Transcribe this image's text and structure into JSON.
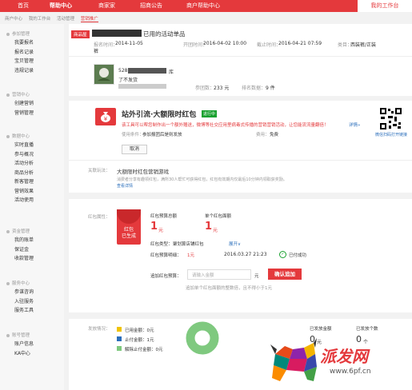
{
  "topnav": {
    "home": "首页",
    "help": "帮助中心",
    "rules": "规则",
    "seller": "商家家",
    "announce": "招商公告",
    "merchant_help": "商户帮助中心",
    "my_workbench": "我的工作台"
  },
  "breadcrumb": [
    "商户中心",
    "我的工作台",
    "活动管理",
    "营销推广"
  ],
  "sidebar": {
    "groups": [
      {
        "title": "参加管理",
        "items": [
          "我要报名",
          "报名记录",
          "宝贝管理",
          "违规记录"
        ]
      },
      {
        "title": "营销中心",
        "items": [
          "创建营销",
          "营销管理"
        ]
      },
      {
        "title": "数据中心",
        "items": [
          "实时直播",
          "参与概况",
          "活动分析",
          "商品分析",
          "新客管理",
          "营销效果",
          "活动使用"
        ]
      },
      {
        "title": "资金管理",
        "items": [
          "我的账单",
          "保证金",
          "收款管理"
        ]
      },
      {
        "title": "服务中心",
        "items": [
          "参谋咨询",
          "入驻服务",
          "服务工具"
        ]
      },
      {
        "title": "账号管理",
        "items": [
          "账户信息",
          "KA中心"
        ]
      }
    ]
  },
  "activity": {
    "badge": "商品屋",
    "title": "已用的活动单品",
    "signup_time_label": "报名时间：",
    "signup_time": "2014-11-05",
    "start_time_label": "开团时间：",
    "start_time": "2016-04-02 10:00",
    "end_time_label": "截止时间：",
    "end_time": "2016-04-21 07:59",
    "category_label": "类目：",
    "category": "西装裤/正装",
    "category_cont": "裤",
    "product_desc": "了不发货",
    "product_id_prefix": "528",
    "stock_label": "库",
    "participants_label": "参团数：",
    "participants": "233 元",
    "ranking_label": "排名数据：",
    "ranking": "9 件"
  },
  "promo": {
    "title": "站外引流·大额限时红包",
    "status": "进行中",
    "desc": "该工具可以帮您制作出一个额外赠送，微博等社交应用里病毒式传播的营销营销活动，让您能流流量翻倍！",
    "detail_link": "详情»",
    "usage_label": "使用条件：",
    "usage": "参加报团后是则发放",
    "fee_label": "费用：",
    "fee": "免费",
    "cancel_btn": "取消",
    "qr_label": "微信扫码打开链接"
  },
  "associated": {
    "label": "关联玩法：",
    "title": "大额限时红包营销游戏",
    "desc": "消费者分享有趣领红包，满所30人帮忙可获得红包，红包有效期内仅最后10分钟内领取获奖励。",
    "link": "查看详情"
  },
  "redpacket": {
    "section_label": "红包属性：",
    "card_line1": "红包",
    "card_line2": "已生成",
    "budget_label": "红包预算总额",
    "budget_value": "1",
    "budget_unit": "元",
    "single_label": "单个红包面额",
    "single_value": "1",
    "single_unit": "元",
    "type_label": "红包类型：",
    "type_value": "聚划算店铺红包",
    "expand": "展开∨",
    "usage_label": "红包预算明细：",
    "usage_value": "1元",
    "date": "2016.03.27 21:23",
    "paid_status": "已付成功",
    "add_label": "追加红包预算：",
    "add_placeholder": "请输入金额",
    "add_unit": "元",
    "add_button": "确认追加",
    "hint": "追加单个红包面额的整数倍，且不得小于1元"
  },
  "distribution": {
    "label": "发放情况：",
    "used": "已用金额：0元",
    "paid": "止付金额：1元",
    "refunded": "解除止付金额：0元",
    "issued_label": "已发放金额",
    "issued_value": "0",
    "issued_unit": "元",
    "count_label": "已发放个数",
    "count_value": "0",
    "count_unit": "个"
  },
  "watermark": {
    "brand": "派发网",
    "url": "www.6pf.cn"
  },
  "colors": {
    "accent": "#e4393c",
    "green": "#7fc97f",
    "link": "#2a6ebb"
  }
}
